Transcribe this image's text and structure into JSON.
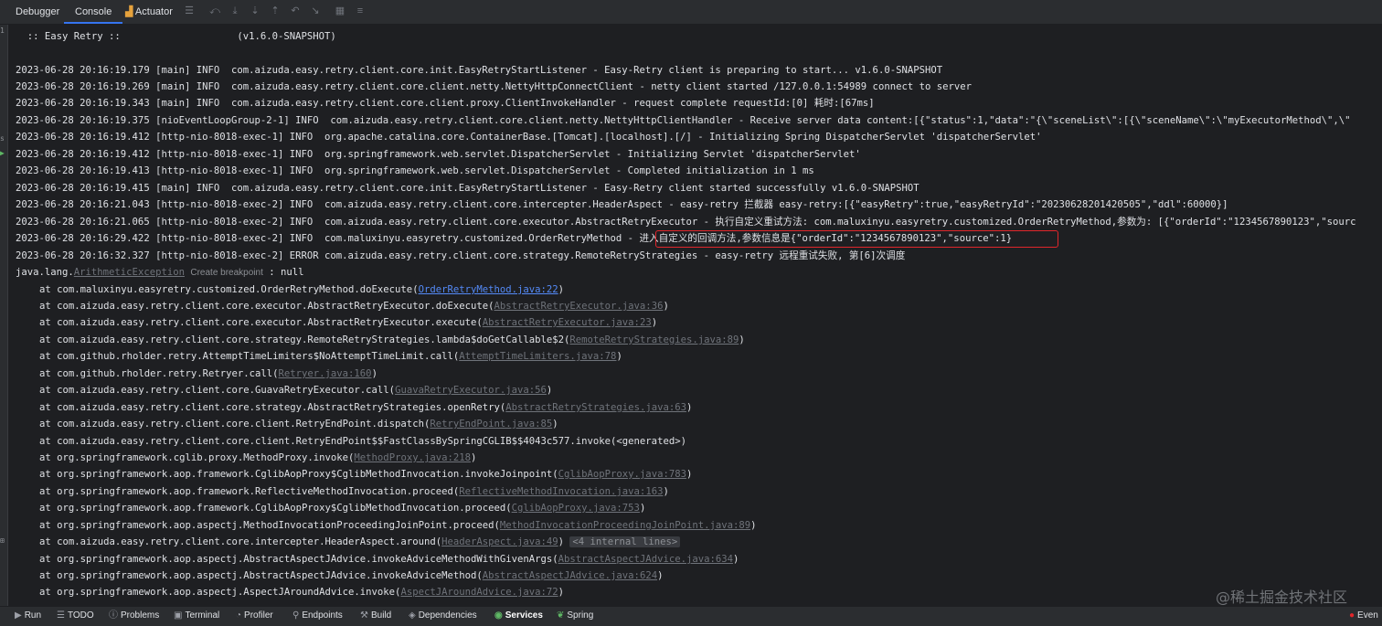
{
  "toolbar": {
    "tabs": [
      {
        "label": "Debugger"
      },
      {
        "label": "Console"
      },
      {
        "label": "Actuator"
      }
    ]
  },
  "console": {
    "banner": "  :: Easy Retry ::                    (v1.6.0-SNAPSHOT)",
    "logs": [
      "2023-06-28 20:16:19.179 [main] INFO  com.aizuda.easy.retry.client.core.init.EasyRetryStartListener - Easy-Retry client is preparing to start... v1.6.0-SNAPSHOT",
      "2023-06-28 20:16:19.269 [main] INFO  com.aizuda.easy.retry.client.core.client.netty.NettyHttpConnectClient - netty client started /127.0.0.1:54989 connect to server",
      "2023-06-28 20:16:19.343 [main] INFO  com.aizuda.easy.retry.client.core.client.proxy.ClientInvokeHandler - request complete requestId:[0] 耗时:[67ms]",
      "2023-06-28 20:16:19.375 [nioEventLoopGroup-2-1] INFO  com.aizuda.easy.retry.client.core.client.netty.NettyHttpClientHandler - Receive server data content:[{\"status\":1,\"data\":\"{\\\"sceneList\\\":[{\\\"sceneName\\\":\\\"myExecutorMethod\\\",\\\"",
      "2023-06-28 20:16:19.412 [http-nio-8018-exec-1] INFO  org.apache.catalina.core.ContainerBase.[Tomcat].[localhost].[/] - Initializing Spring DispatcherServlet 'dispatcherServlet'",
      "2023-06-28 20:16:19.412 [http-nio-8018-exec-1] INFO  org.springframework.web.servlet.DispatcherServlet - Initializing Servlet 'dispatcherServlet'",
      "2023-06-28 20:16:19.413 [http-nio-8018-exec-1] INFO  org.springframework.web.servlet.DispatcherServlet - Completed initialization in 1 ms",
      "2023-06-28 20:16:19.415 [main] INFO  com.aizuda.easy.retry.client.core.init.EasyRetryStartListener - Easy-Retry client started successfully v1.6.0-SNAPSHOT",
      "2023-06-28 20:16:21.043 [http-nio-8018-exec-2] INFO  com.aizuda.easy.retry.client.core.intercepter.HeaderAspect - easy-retry 拦截器 easy-retry:[{\"easyRetry\":true,\"easyRetryId\":\"20230628201420505\",\"ddl\":60000}]",
      "2023-06-28 20:16:21.065 [http-nio-8018-exec-2] INFO  com.aizuda.easy.retry.client.core.executor.AbstractRetryExecutor - 执行自定义重试方法: com.maluxinyu.easyretry.customized.OrderRetryMethod,参数为: [{\"orderId\":\"1234567890123\",\"sourc",
      "2023-06-28 20:16:29.422 [http-nio-8018-exec-2] INFO  com.maluxinyu.easyretry.customized.OrderRetryMethod - 进入自定义的回调方法,参数信息是{\"orderId\":\"1234567890123\",\"source\":1}",
      "2023-06-28 20:16:32.327 [http-nio-8018-exec-2] ERROR com.aizuda.easy.retry.client.core.strategy.RemoteRetryStrategies - easy-retry 远程重试失败, 第[6]次调度"
    ],
    "exception": {
      "prefix": "java.lang.",
      "name": "ArithmeticException",
      "hint": "Create breakpoint",
      "suffix": " : null"
    },
    "trace": [
      {
        "text": "at com.maluxinyu.easyretry.customized.OrderRetryMethod.doExecute(",
        "link": "OrderRetryMethod.java:22"
      },
      {
        "text": "at com.aizuda.easy.retry.client.core.executor.AbstractRetryExecutor.doExecute(",
        "link": "AbstractRetryExecutor.java:36"
      },
      {
        "text": "at com.aizuda.easy.retry.client.core.executor.AbstractRetryExecutor.execute(",
        "link": "AbstractRetryExecutor.java:23"
      },
      {
        "text": "at com.aizuda.easy.retry.client.core.strategy.RemoteRetryStrategies.lambda$doGetCallable$2(",
        "link": "RemoteRetryStrategies.java:89"
      },
      {
        "text": "at com.github.rholder.retry.AttemptTimeLimiters$NoAttemptTimeLimit.call(",
        "link": "AttemptTimeLimiters.java:78"
      },
      {
        "text": "at com.github.rholder.retry.Retryer.call(",
        "link": "Retryer.java:160"
      },
      {
        "text": "at com.aizuda.easy.retry.client.core.GuavaRetryExecutor.call(",
        "link": "GuavaRetryExecutor.java:56"
      },
      {
        "text": "at com.aizuda.easy.retry.client.core.strategy.AbstractRetryStrategies.openRetry(",
        "link": "AbstractRetryStrategies.java:63"
      },
      {
        "text": "at com.aizuda.easy.retry.client.core.client.RetryEndPoint.dispatch(",
        "link": "RetryEndPoint.java:85"
      },
      {
        "text": "at com.aizuda.easy.retry.client.core.client.RetryEndPoint$$FastClassBySpringCGLIB$$4043c577.invoke(<generated>)",
        "link": ""
      },
      {
        "text": "at org.springframework.cglib.proxy.MethodProxy.invoke(",
        "link": "MethodProxy.java:218"
      },
      {
        "text": "at org.springframework.aop.framework.CglibAopProxy$CglibMethodInvocation.invokeJoinpoint(",
        "link": "CglibAopProxy.java:783"
      },
      {
        "text": "at org.springframework.aop.framework.ReflectiveMethodInvocation.proceed(",
        "link": "ReflectiveMethodInvocation.java:163"
      },
      {
        "text": "at org.springframework.aop.framework.CglibAopProxy$CglibMethodInvocation.proceed(",
        "link": "CglibAopProxy.java:753"
      },
      {
        "text": "at org.springframework.aop.aspectj.MethodInvocationProceedingJoinPoint.proceed(",
        "link": "MethodInvocationProceedingJoinPoint.java:89"
      },
      {
        "text": "at com.aizuda.easy.retry.client.core.intercepter.HeaderAspect.around(",
        "link": "HeaderAspect.java:49"
      },
      {
        "text": "at org.springframework.aop.aspectj.AbstractAspectJAdvice.invokeAdviceMethodWithGivenArgs(",
        "link": "AbstractAspectJAdvice.java:634"
      },
      {
        "text": "at org.springframework.aop.aspectj.AbstractAspectJAdvice.invokeAdviceMethod(",
        "link": "AbstractAspectJAdvice.java:624"
      },
      {
        "text": "at org.springframework.aop.aspectj.AspectJAroundAdvice.invoke(",
        "link": "AspectJAroundAdvice.java:72"
      }
    ],
    "collapsed_label": "<4 internal lines>"
  },
  "bottom_tabs": [
    {
      "label": "Run",
      "icon": "play-icon"
    },
    {
      "label": "TODO",
      "icon": "list-icon"
    },
    {
      "label": "Problems",
      "icon": "warning-icon"
    },
    {
      "label": "Terminal",
      "icon": "terminal-icon"
    },
    {
      "label": "Profiler",
      "icon": "profiler-icon"
    },
    {
      "label": "Endpoints",
      "icon": "endpoints-icon"
    },
    {
      "label": "Build",
      "icon": "hammer-icon"
    },
    {
      "label": "Dependencies",
      "icon": "dependencies-icon"
    },
    {
      "label": "Services",
      "icon": "services-icon"
    },
    {
      "label": "Spring",
      "icon": "spring-icon"
    }
  ],
  "event_log": {
    "label": "Even"
  },
  "watermark": "@稀土掘金技术社区",
  "colors": {
    "highlight_box": "#e1262b",
    "link": "#548af7",
    "console_bg": "#1e1f22"
  }
}
